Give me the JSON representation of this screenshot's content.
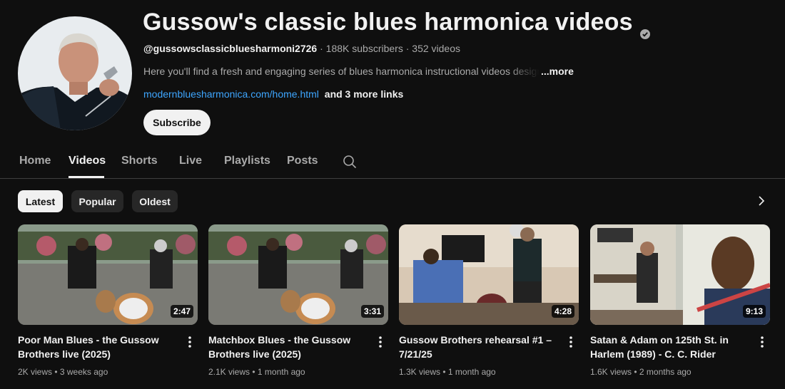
{
  "channel": {
    "title": "Gussow's classic blues harmonica videos",
    "handle": "@gussowsclassicbluesharmoni2726",
    "subscribers": "188K subscribers",
    "video_count": "352 videos",
    "separator": " · ",
    "description": "Here you'll find a fresh and engaging series of blues harmonica instructional videos designed",
    "more_label": "...more",
    "link": "modernbluesharmonica.com/home.html",
    "more_links": "and 3 more links",
    "subscribe_label": "Subscribe",
    "avatar_icon": "channel-avatar"
  },
  "tabs": [
    {
      "label": "Home"
    },
    {
      "label": "Videos",
      "active": true
    },
    {
      "label": "Shorts"
    },
    {
      "label": "Live"
    },
    {
      "label": "Playlists"
    },
    {
      "label": "Posts"
    }
  ],
  "chips": [
    {
      "label": "Latest",
      "active": true
    },
    {
      "label": "Popular"
    },
    {
      "label": "Oldest"
    }
  ],
  "videos": [
    {
      "title": "Poor Man Blues - the Gussow Brothers live (2025)",
      "duration": "2:47",
      "meta": "2K views • 3 weeks ago"
    },
    {
      "title": "Matchbox Blues - the Gussow Brothers live (2025)",
      "duration": "3:31",
      "meta": "2.1K views • 1 month ago"
    },
    {
      "title": "Gussow Brothers rehearsal #1 – 7/21/25",
      "duration": "4:28",
      "meta": "1.3K views • 1 month ago"
    },
    {
      "title": "Satan & Adam on 125th St. in Harlem (1989) - C. C. Rider",
      "duration": "9:13",
      "meta": "1.6K views • 2 months ago"
    }
  ],
  "colors": {
    "background": "#0f0f0f",
    "link": "#3ea6ff",
    "text": "#f1f1f1",
    "secondary": "#aaaaaa"
  }
}
